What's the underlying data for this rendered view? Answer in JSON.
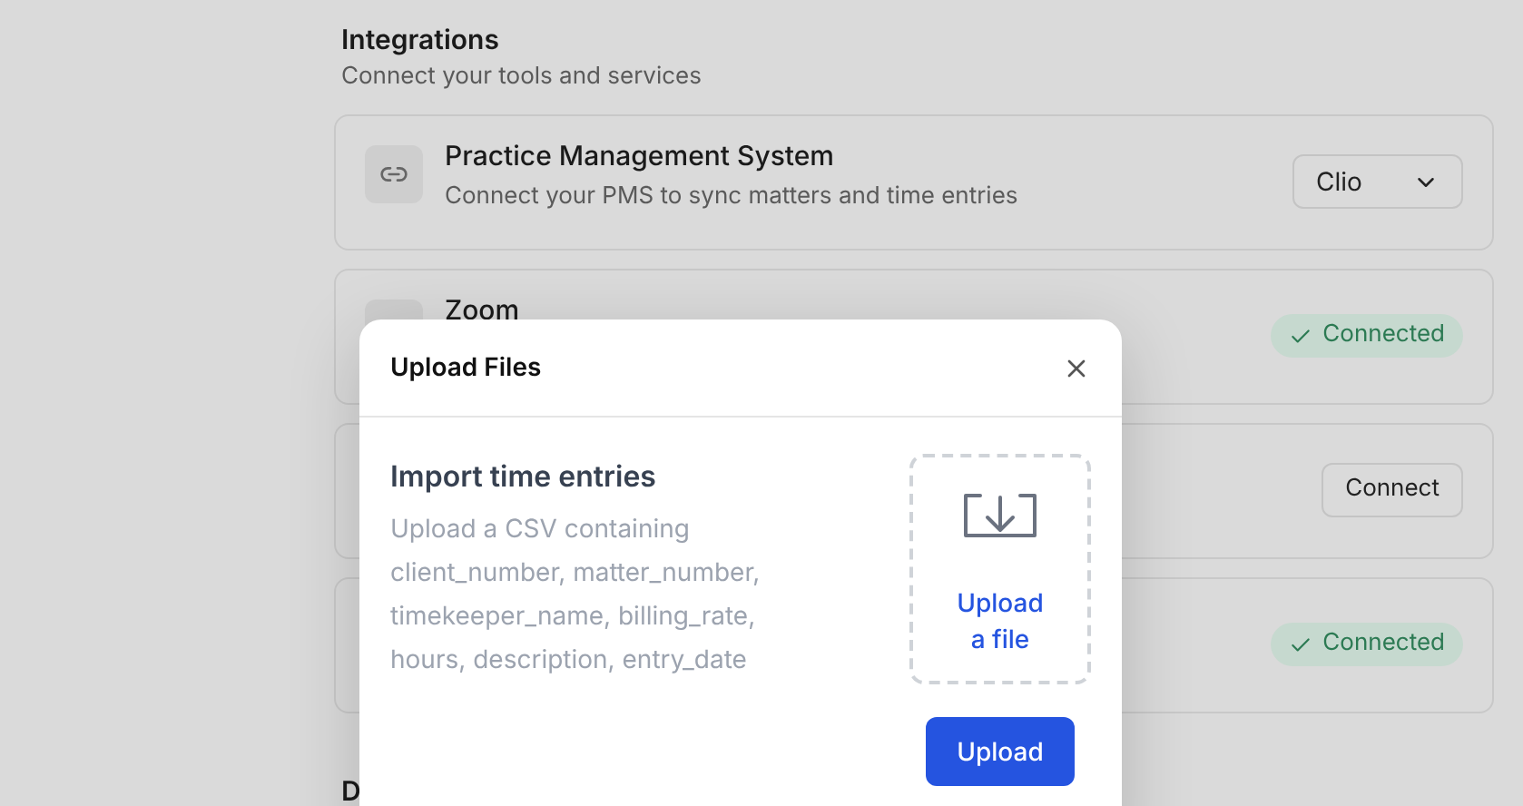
{
  "section": {
    "title": "Integrations",
    "subtitle": "Connect your tools and services"
  },
  "integrations": [
    {
      "kind": "select",
      "title": "Practice Management System",
      "description": "Connect your PMS to sync matters and time entries",
      "value": "Clio"
    },
    {
      "kind": "badge",
      "title": "Zoom",
      "status": "Connected"
    },
    {
      "kind": "button",
      "action": "Connect"
    },
    {
      "kind": "badge",
      "status": "Connected"
    }
  ],
  "next_section": {
    "title": "D"
  },
  "modal": {
    "title": "Upload Files",
    "heading": "Import time entries",
    "description": "Upload a CSV containing client_number, matter_number, timekeeper_name, billing_rate, hours, description, entry_date",
    "dropzone_label": "Upload a file",
    "submit": "Upload"
  }
}
